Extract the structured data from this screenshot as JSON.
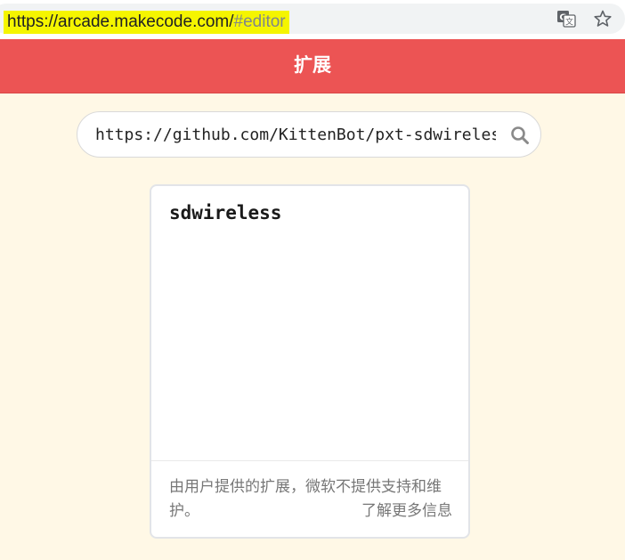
{
  "browser": {
    "url_main": "https://arcade.makecode.com/",
    "url_hash": "#editor"
  },
  "dialog": {
    "title": "扩展"
  },
  "search": {
    "value": "https://github.com/KittenBot/pxt-sdwireless"
  },
  "card": {
    "name": "sdwireless",
    "disclaimer": "由用户提供的扩展，微软不提供支持和维护。",
    "learn_more": "了解更多信息"
  },
  "colors": {
    "header": "#ec5454",
    "background": "#fff8e6",
    "url_highlight": "#f5f500"
  },
  "icons": [
    "lock-icon",
    "translate-icon",
    "star-icon",
    "search-icon"
  ]
}
